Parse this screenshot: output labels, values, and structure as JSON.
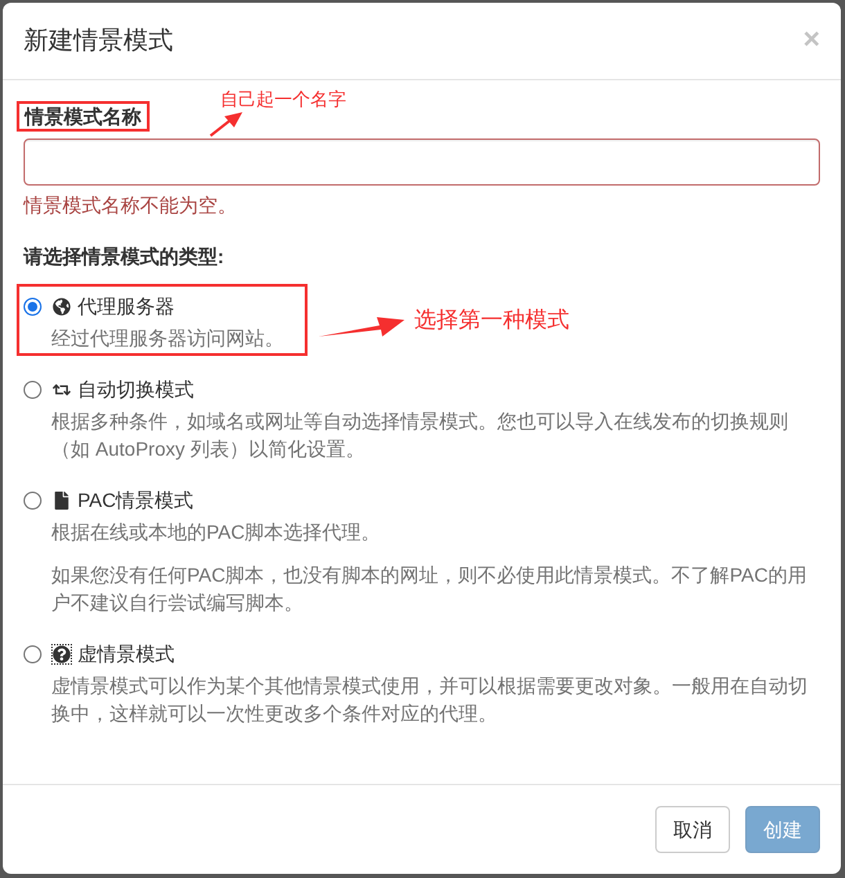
{
  "dialog": {
    "title": "新建情景模式",
    "close": "×"
  },
  "name_field": {
    "label": "情景模式名称",
    "highlighted": true,
    "annotation": "自己起一个名字",
    "invalid": true,
    "error": "情景模式名称不能为空。"
  },
  "type_label": "请选择情景模式的类型:",
  "options": [
    {
      "kind": "proxy",
      "title": "代理服务器",
      "description": [
        "经过代理服务器访问网站。"
      ],
      "selected": true,
      "highlighted": true,
      "annotation": "选择第一种模式",
      "focused": false
    },
    {
      "kind": "switch",
      "title": "自动切换模式",
      "description": [
        "根据多种条件，如域名或网址等自动选择情景模式。您也可以导入在线发布的切换规则（如 AutoProxy 列表）以简化设置。"
      ],
      "selected": false,
      "highlighted": false,
      "focused": false
    },
    {
      "kind": "pac",
      "title": "PAC情景模式",
      "description": [
        "根据在线或本地的PAC脚本选择代理。",
        "如果您没有任何PAC脚本，也没有脚本的网址，则不必使用此情景模式。不了解PAC的用户不建议自行尝试编写脚本。"
      ],
      "selected": false,
      "highlighted": false,
      "focused": false
    },
    {
      "kind": "virtual",
      "title": "虚情景模式",
      "description": [
        "虚情景模式可以作为某个其他情景模式使用，并可以根据需要更改对象。一般用在自动切换中，这样就可以一次性更改多个条件对应的代理。"
      ],
      "selected": false,
      "highlighted": false,
      "focused": true
    }
  ],
  "buttons": [
    {
      "kind": "cancel",
      "label": "取消",
      "disabled": false
    },
    {
      "kind": "create",
      "label": "创建",
      "disabled": true
    }
  ]
}
